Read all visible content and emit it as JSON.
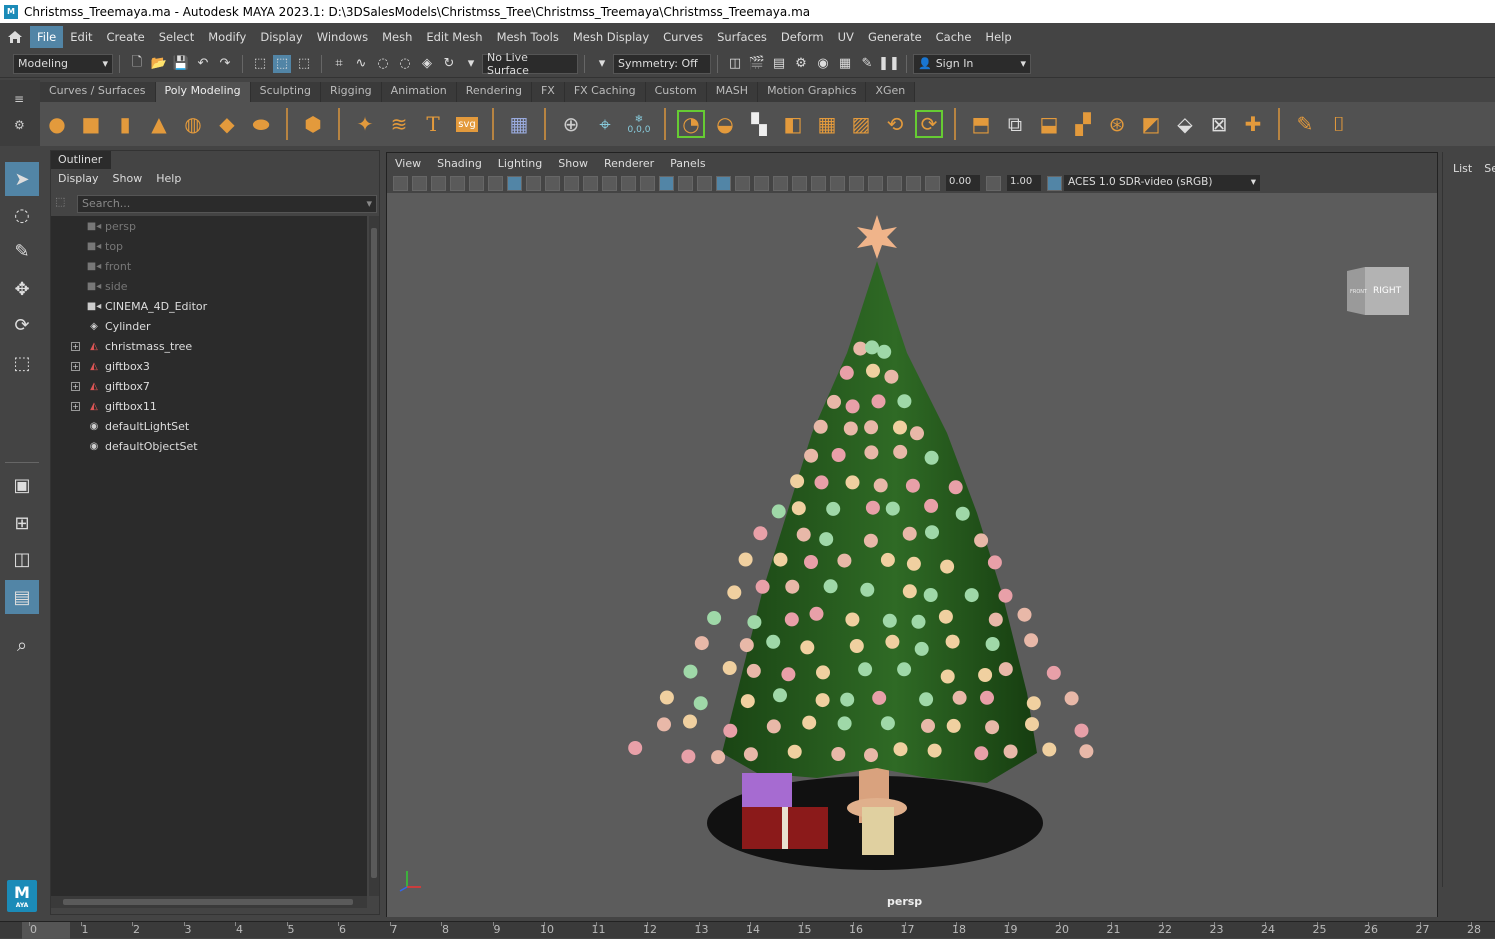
{
  "window": {
    "title": "Christmss_Treemaya.ma - Autodesk MAYA 2023.1: D:\\3DSalesModels\\Christmss_Tree\\Christmss_Treemaya\\Christmss_Treemaya.ma",
    "app_icon": "M"
  },
  "menubar": {
    "items": [
      "File",
      "Edit",
      "Create",
      "Select",
      "Modify",
      "Display",
      "Windows",
      "Mesh",
      "Edit Mesh",
      "Mesh Tools",
      "Mesh Display",
      "Curves",
      "Surfaces",
      "Deform",
      "UV",
      "Generate",
      "Cache",
      "Help"
    ],
    "active": "File"
  },
  "statusline": {
    "mode": "Modeling",
    "live_surface": "No Live Surface",
    "symmetry": "Symmetry: Off",
    "sign_in": "Sign In"
  },
  "shelf": {
    "tabs": [
      "Curves / Surfaces",
      "Poly Modeling",
      "Sculpting",
      "Rigging",
      "Animation",
      "Rendering",
      "FX",
      "FX Caching",
      "Custom",
      "MASH",
      "Motion Graphics",
      "XGen"
    ],
    "active_tab": "Poly Modeling",
    "svg_label": "svg",
    "coord_label": "0,0,0",
    "accent": "#e39a3c"
  },
  "outliner": {
    "title": "Outliner",
    "menu": [
      "Display",
      "Show",
      "Help"
    ],
    "search_placeholder": "Search...",
    "items": [
      {
        "label": "persp",
        "icon": "camera-icon",
        "dim": true,
        "expandable": false
      },
      {
        "label": "top",
        "icon": "camera-icon",
        "dim": true,
        "expandable": false
      },
      {
        "label": "front",
        "icon": "camera-icon",
        "dim": true,
        "expandable": false
      },
      {
        "label": "side",
        "icon": "camera-icon",
        "dim": true,
        "expandable": false
      },
      {
        "label": "CINEMA_4D_Editor",
        "icon": "camera-icon",
        "dim": false,
        "expandable": false
      },
      {
        "label": "Cylinder",
        "icon": "locator-icon",
        "dim": false,
        "expandable": false
      },
      {
        "label": "christmass_tree",
        "icon": "mesh-group-icon",
        "dim": false,
        "expandable": true
      },
      {
        "label": "giftbox3",
        "icon": "mesh-group-icon",
        "dim": false,
        "expandable": true
      },
      {
        "label": "giftbox7",
        "icon": "mesh-group-icon",
        "dim": false,
        "expandable": true
      },
      {
        "label": "giftbox11",
        "icon": "mesh-group-icon",
        "dim": false,
        "expandable": true
      },
      {
        "label": "defaultLightSet",
        "icon": "set-icon",
        "dim": false,
        "expandable": false
      },
      {
        "label": "defaultObjectSet",
        "icon": "set-icon",
        "dim": false,
        "expandable": false
      }
    ]
  },
  "viewport": {
    "menu": [
      "View",
      "Shading",
      "Lighting",
      "Show",
      "Renderer",
      "Panels"
    ],
    "exposure": "0.00",
    "gamma": "1.00",
    "color_space": "ACES 1.0 SDR-video (sRGB)",
    "camera": "persp",
    "viewcube_front": "FRONT",
    "viewcube_right": "RIGHT",
    "bg_color": "#5c5c5c"
  },
  "channel_box": {
    "tabs": [
      "List",
      "Se"
    ]
  },
  "timeline": {
    "frames": [
      "0",
      "1",
      "2",
      "3",
      "4",
      "5",
      "6",
      "7",
      "8",
      "9",
      "10",
      "11",
      "12",
      "13",
      "14",
      "15",
      "16",
      "17",
      "18",
      "19",
      "20",
      "21",
      "22",
      "23",
      "24",
      "25",
      "26",
      "27",
      "28"
    ]
  },
  "maya_logo": {
    "letter": "M",
    "word": "AYA"
  }
}
